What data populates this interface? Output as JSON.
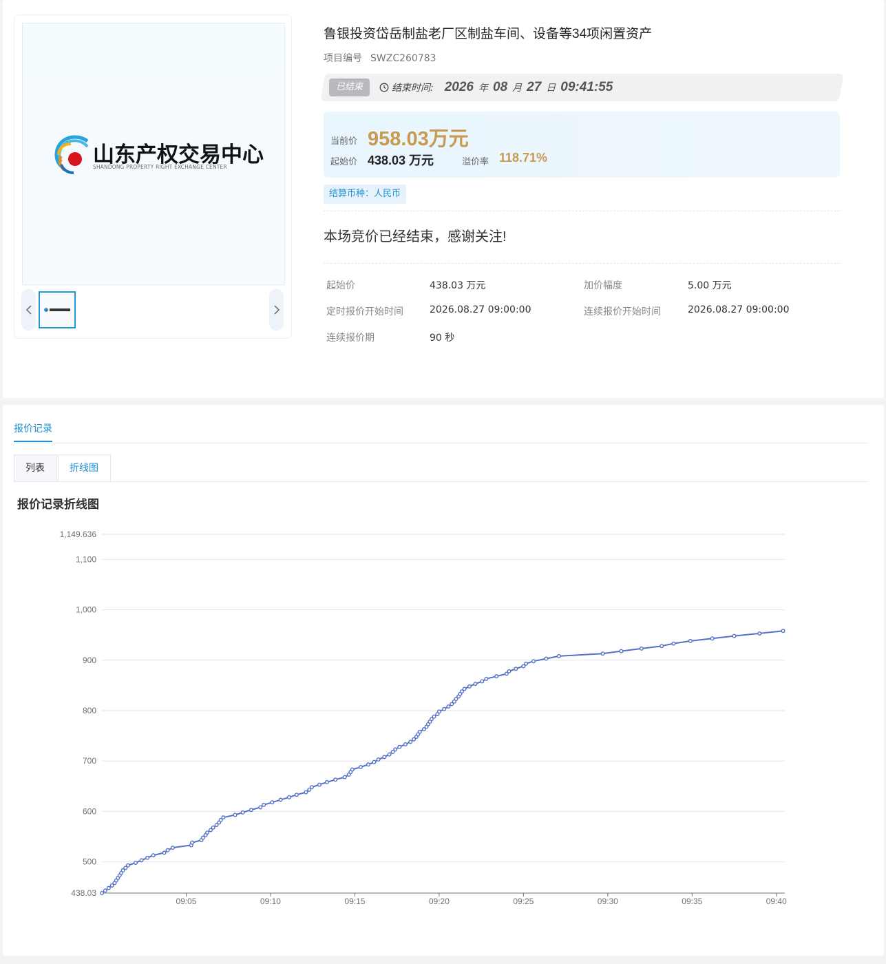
{
  "logo": {
    "text_cn": "山东产权交易中心",
    "text_en": "SHANDONG PROPERTY RIGHT EXCHANGE CENTER"
  },
  "header": {
    "title": "鲁银投资岱岳制盐老厂区制盐车间、设备等34项闲置资产",
    "project_no_label": "项目编号",
    "project_no": "SWZC260783"
  },
  "status": {
    "badge": "已结束",
    "end_label": "结束时间:",
    "year": "2026",
    "year_unit": "年",
    "month": "08",
    "month_unit": "月",
    "day": "27",
    "day_unit": "日",
    "time": "09:41:55"
  },
  "price": {
    "current_label": "当前价",
    "current_value": "958.03万元",
    "start_label": "起始价",
    "start_value": "438.03 万元",
    "premium_label": "溢价率",
    "premium_value": "118.71%"
  },
  "currency_tag": "结算币种：人民币",
  "ended_message": "本场竞价已经结束，感谢关注!",
  "details": {
    "start_price_label": "起始价",
    "start_price": "438.03 万元",
    "increment_label": "加价幅度",
    "increment": "5.00 万元",
    "timed_start_label": "定时报价开始时间",
    "timed_start": "2026.08.27 09:00:00",
    "cont_start_label": "连续报价开始时间",
    "cont_start": "2026.08.27 09:00:00",
    "cont_period_label": "连续报价期",
    "cont_period": "90 秒"
  },
  "tabs": {
    "main": "报价记录",
    "sub_list": "列表",
    "sub_chart": "折线图"
  },
  "chart_title": "报价记录折线图",
  "colors": {
    "accent": "#1d8fcf",
    "price_gold": "#c99a52",
    "line": "#5470c6"
  },
  "chart_data": {
    "type": "line",
    "title": "报价记录折线图",
    "xlabel": "",
    "ylabel": "",
    "x_unit": "minutes since 09:00",
    "xlim": [
      0,
      40.5
    ],
    "ylim": [
      438.03,
      1149.636
    ],
    "y_ticks": [
      438.03,
      500,
      600,
      700,
      800,
      900,
      1000,
      1100,
      1149.636
    ],
    "y_tick_labels": [
      "438.03",
      "500",
      "600",
      "700",
      "800",
      "900",
      "1,000",
      "1,100",
      "1,149.636"
    ],
    "x_ticks": [
      5,
      10,
      15,
      20,
      25,
      30,
      35,
      40
    ],
    "x_tick_labels": [
      "09:05",
      "09:10",
      "09:15",
      "09:20",
      "09:25",
      "09:30",
      "09:35",
      "09:40"
    ],
    "grid": true,
    "series": [
      {
        "name": "",
        "points": [
          [
            0.0,
            438.03
          ],
          [
            0.2,
            443.03
          ],
          [
            0.4,
            448.03
          ],
          [
            0.6,
            453.03
          ],
          [
            0.75,
            458.03
          ],
          [
            0.85,
            463.03
          ],
          [
            0.95,
            468.03
          ],
          [
            1.05,
            473.03
          ],
          [
            1.15,
            478.03
          ],
          [
            1.25,
            483.03
          ],
          [
            1.4,
            488.03
          ],
          [
            1.55,
            493.03
          ],
          [
            2.0,
            498.03
          ],
          [
            2.35,
            503.03
          ],
          [
            2.7,
            508.03
          ],
          [
            3.05,
            513.03
          ],
          [
            3.7,
            518.03
          ],
          [
            3.9,
            523.03
          ],
          [
            4.2,
            528.03
          ],
          [
            5.3,
            533.03
          ],
          [
            5.35,
            538.03
          ],
          [
            5.9,
            543.03
          ],
          [
            6.0,
            548.03
          ],
          [
            6.15,
            553.03
          ],
          [
            6.25,
            558.03
          ],
          [
            6.45,
            563.03
          ],
          [
            6.6,
            568.03
          ],
          [
            6.8,
            573.03
          ],
          [
            6.95,
            578.03
          ],
          [
            7.05,
            583.03
          ],
          [
            7.2,
            588.03
          ],
          [
            7.9,
            593.03
          ],
          [
            8.35,
            598.03
          ],
          [
            8.85,
            603.03
          ],
          [
            9.4,
            608.03
          ],
          [
            9.6,
            613.03
          ],
          [
            10.1,
            618.03
          ],
          [
            10.6,
            623.03
          ],
          [
            11.1,
            628.03
          ],
          [
            11.55,
            633.03
          ],
          [
            12.1,
            638.03
          ],
          [
            12.3,
            643.03
          ],
          [
            12.45,
            648.03
          ],
          [
            12.9,
            653.03
          ],
          [
            13.35,
            658.03
          ],
          [
            13.85,
            663.03
          ],
          [
            14.4,
            668.03
          ],
          [
            14.65,
            673.03
          ],
          [
            14.75,
            678.03
          ],
          [
            14.85,
            683.03
          ],
          [
            15.35,
            688.03
          ],
          [
            15.8,
            693.03
          ],
          [
            16.15,
            698.03
          ],
          [
            16.4,
            703.03
          ],
          [
            16.75,
            708.03
          ],
          [
            17.05,
            713.03
          ],
          [
            17.25,
            718.03
          ],
          [
            17.4,
            723.03
          ],
          [
            17.65,
            728.03
          ],
          [
            18.0,
            733.03
          ],
          [
            18.3,
            738.03
          ],
          [
            18.5,
            743.03
          ],
          [
            18.65,
            748.03
          ],
          [
            18.75,
            753.03
          ],
          [
            18.85,
            758.03
          ],
          [
            19.1,
            763.03
          ],
          [
            19.25,
            768.03
          ],
          [
            19.35,
            773.03
          ],
          [
            19.45,
            778.03
          ],
          [
            19.55,
            783.03
          ],
          [
            19.7,
            788.03
          ],
          [
            19.9,
            793.03
          ],
          [
            20.0,
            798.03
          ],
          [
            20.3,
            803.03
          ],
          [
            20.55,
            808.03
          ],
          [
            20.75,
            813.03
          ],
          [
            20.9,
            818.03
          ],
          [
            21.0,
            823.03
          ],
          [
            21.15,
            828.03
          ],
          [
            21.25,
            833.03
          ],
          [
            21.35,
            838.03
          ],
          [
            21.5,
            843.03
          ],
          [
            21.8,
            848.03
          ],
          [
            22.15,
            853.03
          ],
          [
            22.55,
            858.03
          ],
          [
            22.8,
            863.03
          ],
          [
            23.4,
            868.03
          ],
          [
            24.0,
            873.03
          ],
          [
            24.15,
            878.03
          ],
          [
            24.55,
            883.03
          ],
          [
            25.0,
            888.03
          ],
          [
            25.15,
            893.03
          ],
          [
            25.6,
            898.03
          ],
          [
            26.35,
            903.03
          ],
          [
            27.1,
            908.03
          ],
          [
            29.7,
            913.03
          ],
          [
            30.8,
            918.03
          ],
          [
            32.0,
            923.03
          ],
          [
            33.2,
            928.03
          ],
          [
            33.9,
            933.03
          ],
          [
            34.9,
            938.03
          ],
          [
            36.2,
            943.03
          ],
          [
            37.5,
            948.03
          ],
          [
            39.0,
            953.03
          ],
          [
            40.4,
            958.03
          ]
        ]
      }
    ]
  }
}
